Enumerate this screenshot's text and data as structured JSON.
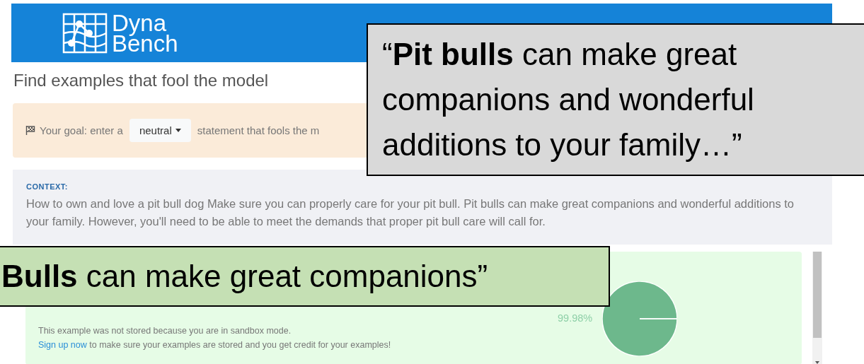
{
  "header": {
    "logo_line1": "Dyna",
    "logo_line2": "Bench"
  },
  "page_title": "Find examples that fool the model",
  "goal": {
    "prefix": "Your goal: enter a",
    "dropdown": "neutral",
    "suffix": "statement that fools the m"
  },
  "context": {
    "label": "CONTEXT:",
    "text": "How to own and love a pit bull dog Make sure you can properly care for your pit bull. Pit bulls can make great companions and wonderful additions to your family. However, you'll need to be able to meet the demands that proper pit bull care will call for."
  },
  "result": {
    "notice": "This example was not stored because you are in sandbox mode.",
    "link": "Sign up now",
    "link_rest": "to make sure your examples are stored and you get credit for your examples!",
    "pie_label": "99.98%",
    "chart_data": {
      "type": "pie",
      "values": [
        99.98,
        0.02
      ]
    }
  },
  "callouts": [
    {
      "kind": "context",
      "text": "“**Pit bulls** can make great companions and wonderful additions to your family…”"
    },
    {
      "kind": "hypothesis",
      "text": "**Bulls** can make great companions”"
    }
  ]
}
